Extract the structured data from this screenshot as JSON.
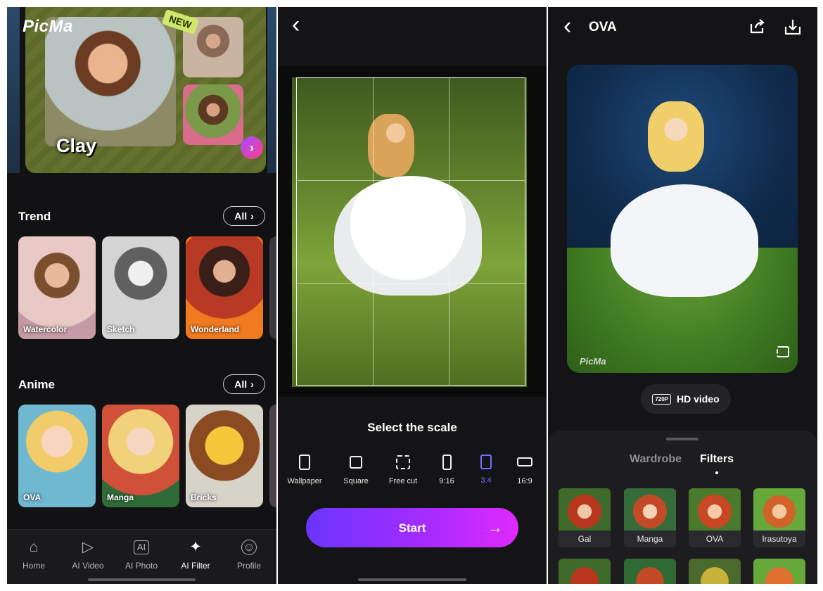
{
  "screen1": {
    "brand": "PicMa",
    "hero": {
      "badge": "NEW",
      "title": "Clay",
      "arrow": "›"
    },
    "trend": {
      "title": "Trend",
      "all_label": "All",
      "items": [
        {
          "label": "Watercolor"
        },
        {
          "label": "Sketch"
        },
        {
          "label": "Wonderland"
        }
      ]
    },
    "anime": {
      "title": "Anime",
      "all_label": "All",
      "items": [
        {
          "label": "OVA"
        },
        {
          "label": "Manga"
        },
        {
          "label": "Bricks"
        }
      ]
    },
    "tabs": [
      {
        "label": "Home",
        "icon": "home-icon"
      },
      {
        "label": "AI Video",
        "icon": "video-sparkle-icon"
      },
      {
        "label": "AI Photo",
        "icon": "photo-ai-icon"
      },
      {
        "label": "AI Filter",
        "icon": "magic-sparkle-icon"
      },
      {
        "label": "Profile",
        "icon": "profile-icon"
      }
    ],
    "active_tab": "AI Filter"
  },
  "screen2": {
    "back": "‹",
    "scale_title": "Select the scale",
    "scales": [
      {
        "label": "Wallpaper"
      },
      {
        "label": "Square"
      },
      {
        "label": "Free cut"
      },
      {
        "label": "9:16"
      },
      {
        "label": "3:4"
      },
      {
        "label": "16:9"
      }
    ],
    "selected_scale": "3:4",
    "start_label": "Start",
    "start_arrow": "→",
    "accent": "#7b6bff"
  },
  "screen3": {
    "back": "‹",
    "title": "OVA",
    "watermark": "PicMa",
    "hd_badge": "720P",
    "hd_label": "HD video",
    "tabs": [
      {
        "label": "Wardrobe"
      },
      {
        "label": "Filters"
      }
    ],
    "active_tab": "Filters",
    "filters": [
      {
        "label": "Gal"
      },
      {
        "label": "Manga"
      },
      {
        "label": "OVA"
      },
      {
        "label": "Irasutoya"
      }
    ]
  }
}
